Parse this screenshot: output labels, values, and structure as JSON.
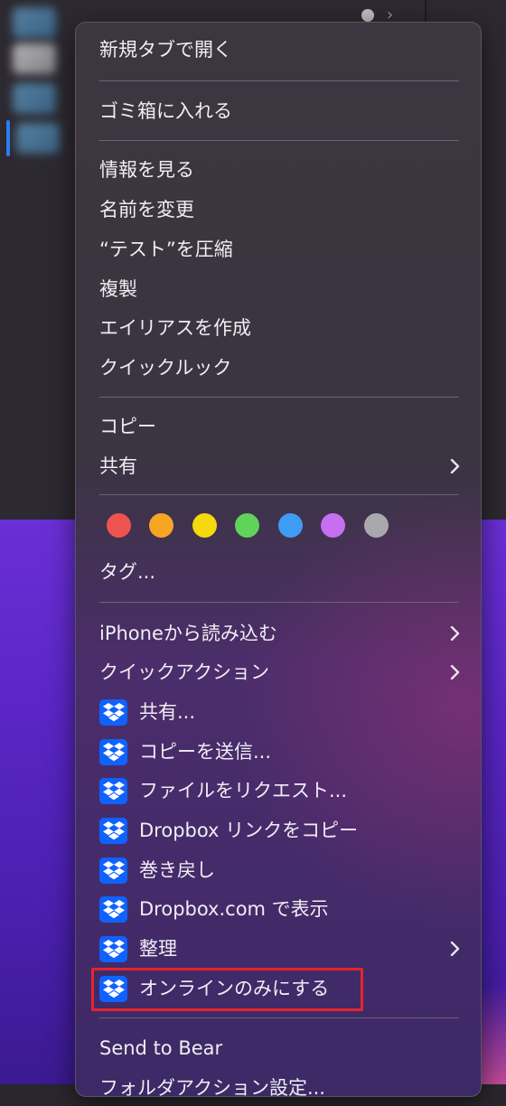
{
  "menu": {
    "groups": {
      "open": {
        "new_tab": "新規タブで開く"
      },
      "trash": {
        "move_to_trash": "ゴミ箱に入れる"
      },
      "file": {
        "get_info": "情報を見る",
        "rename": "名前を変更",
        "compress": "“テスト”を圧縮",
        "duplicate": "複製",
        "make_alias": "エイリアスを作成",
        "quick_look": "クイックルック"
      },
      "copy": {
        "copy": "コピー",
        "share": "共有"
      },
      "tags": {
        "colors": [
          "#ef5350",
          "#f6a623",
          "#f5d90a",
          "#5fd35a",
          "#3f9cf5",
          "#c86ef0",
          "#a9a9ad"
        ],
        "tags_label": "タグ..."
      },
      "extras": {
        "import_from_iphone": "iPhoneから読み込む",
        "quick_actions": "クイックアクション",
        "dropbox_share": "共有...",
        "dropbox_send_copy": "コピーを送信...",
        "dropbox_request_files": "ファイルをリクエスト...",
        "dropbox_copy_link": "Dropbox リンクをコピー",
        "dropbox_rewind": "巻き戻し",
        "dropbox_view_on_web": "Dropbox.com で表示",
        "dropbox_organize": "整理",
        "dropbox_online_only": "オンラインのみにする"
      },
      "services": {
        "send_to_bear": "Send to Bear",
        "folder_actions": "フォルダアクション設定..."
      }
    }
  },
  "annotation": {
    "highlight_color": "#e5242a"
  }
}
